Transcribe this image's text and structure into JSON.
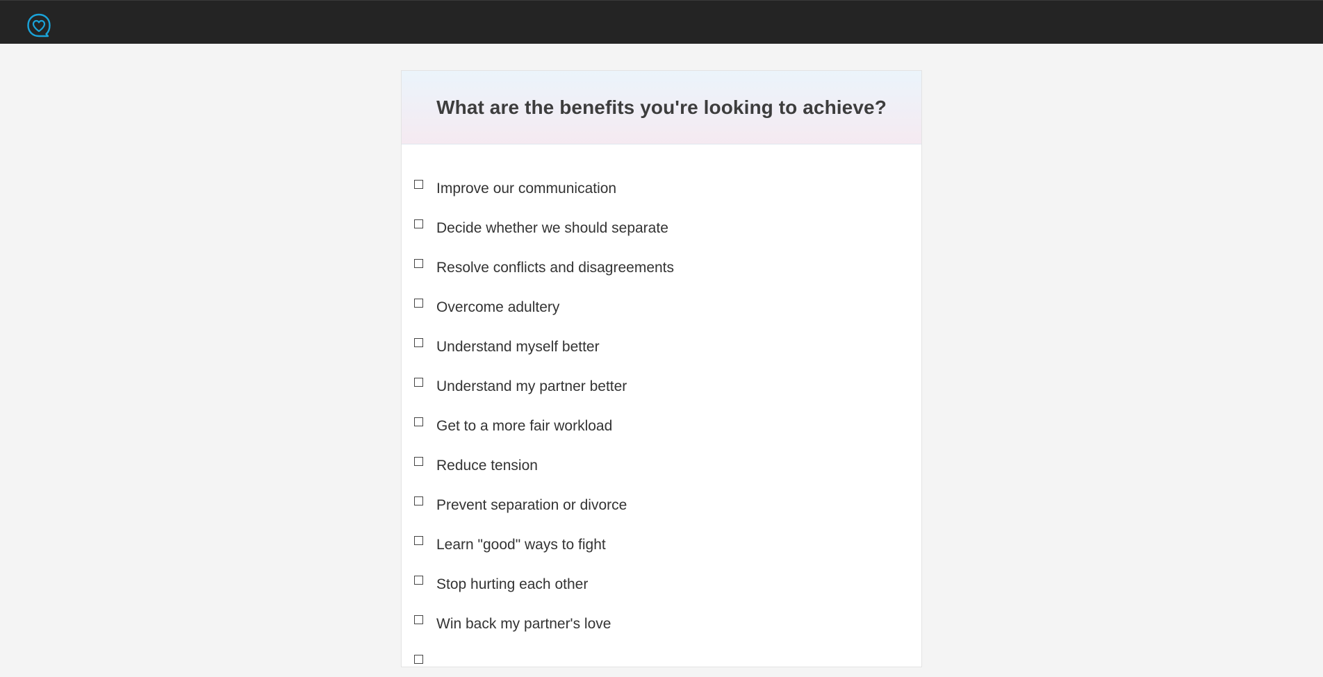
{
  "header": {
    "logo_icon": "heart-chat-bubble-icon",
    "logo_color": "#1aa3d9",
    "background": "#242424"
  },
  "question": {
    "title": "What are the benefits you're looking to achieve?"
  },
  "options": [
    {
      "label": "Improve our communication",
      "checked": false
    },
    {
      "label": "Decide whether we should separate",
      "checked": false
    },
    {
      "label": "Resolve conflicts and disagreements",
      "checked": false
    },
    {
      "label": "Overcome adultery",
      "checked": false
    },
    {
      "label": "Understand myself better",
      "checked": false
    },
    {
      "label": "Understand my partner better",
      "checked": false
    },
    {
      "label": "Get to a more fair workload",
      "checked": false
    },
    {
      "label": "Reduce tension",
      "checked": false
    },
    {
      "label": "Prevent separation or divorce",
      "checked": false
    },
    {
      "label": "Learn \"good\" ways to fight",
      "checked": false
    },
    {
      "label": "Stop hurting each other",
      "checked": false
    },
    {
      "label": "Win back my partner's love",
      "checked": false
    },
    {
      "label": "",
      "checked": false
    }
  ]
}
